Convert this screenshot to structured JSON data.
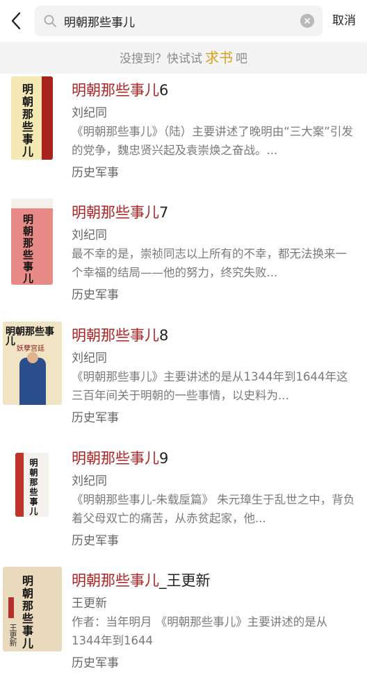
{
  "header": {
    "search_value": "明朝那些事儿",
    "cancel_label": "取消"
  },
  "hint": {
    "prefix": "没搜到？快试试",
    "request_label": "求书",
    "suffix": "吧"
  },
  "results": [
    {
      "title": "明朝那些事儿",
      "title_suffix": "6",
      "author": "刘纪同",
      "description": "《明朝那些事儿》（陆）主要讲述了晚明由“三大案”引发的党争，魏忠贤兴起及袁崇焕之奋战。...",
      "category": "历史军事",
      "cover_text": "明朝那些事儿"
    },
    {
      "title": "明朝那些事儿",
      "title_suffix": "7",
      "author": "刘纪同",
      "description": "最不幸的是，崇祯同志以上所有的不幸，都无法换来一个幸福的结局——他的努力，终究失败...",
      "category": "历史军事",
      "cover_text": "明朝那些事儿"
    },
    {
      "title": "明朝那些事儿",
      "title_suffix": "8",
      "author": "刘纪同",
      "description": "《明朝那些事儿》主要讲述的是从1344年到1644年这三百年间关于明朝的一些事情，以史料为...",
      "category": "历史军事",
      "cover_text": "明朝那些事儿",
      "cover_subtitle": "妖孽宫廷"
    },
    {
      "title": "明朝那些事儿",
      "title_suffix": "9",
      "author": "刘纪同",
      "description": "《明朝那些事儿-朱载垕篇》 朱元璋生于乱世之中，背负着父母双亡的痛苦，从赤贫起家，他...",
      "category": "历史军事",
      "cover_text": "明朝那些事儿"
    },
    {
      "title": "明朝那些事儿",
      "title_suffix": "_王更新",
      "author": "王更新",
      "description": "作者：当年明月 《明朝那些事儿》主要讲述的是从1344年到1644",
      "category": "历史军事",
      "cover_text": "明朝那些事儿",
      "cover_author": "王更新"
    }
  ],
  "colors": {
    "title_red": "#b22222",
    "request_gold": "#d9a11c",
    "hint_bg": "#f4f4f4"
  }
}
